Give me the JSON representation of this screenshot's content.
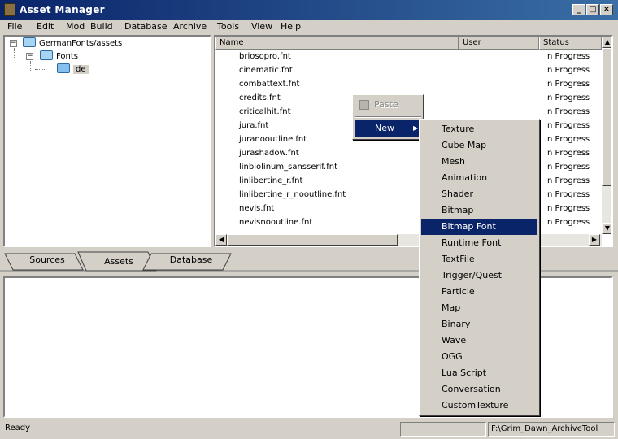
{
  "window": {
    "title": "Asset Manager"
  },
  "menu": [
    "File",
    "Edit",
    "Mod",
    "Build",
    "Database",
    "Archive",
    "Tools",
    "View",
    "Help"
  ],
  "tree": {
    "root": "GermanFonts/assets",
    "child": "Fonts",
    "leaf": "de"
  },
  "list": {
    "columns": {
      "name": "Name",
      "user": "User",
      "status": "Status"
    },
    "rows": [
      {
        "name": "briosopro.fnt",
        "status": "In Progress"
      },
      {
        "name": "cinematic.fnt",
        "status": "In Progress"
      },
      {
        "name": "combattext.fnt",
        "status": "In Progress"
      },
      {
        "name": "credits.fnt",
        "status": "In Progress"
      },
      {
        "name": "criticalhit.fnt",
        "status": "In Progress"
      },
      {
        "name": "jura.fnt",
        "status": "In Progress"
      },
      {
        "name": "juranooutline.fnt",
        "status": "In Progress"
      },
      {
        "name": "jurashadow.fnt",
        "status": "In Progress"
      },
      {
        "name": "linbiolinum_sansserif.fnt",
        "status": "In Progress"
      },
      {
        "name": "linlibertine_r.fnt",
        "status": "In Progress"
      },
      {
        "name": "linlibertine_r_nooutline.fnt",
        "status": "In Progress"
      },
      {
        "name": "nevis.fnt",
        "status": "In Progress"
      },
      {
        "name": "nevisnooutline.fnt",
        "status": "In Progress"
      }
    ]
  },
  "tabs": [
    "Sources",
    "Assets",
    "Database"
  ],
  "context_menu": {
    "paste": "Paste",
    "new": "New"
  },
  "submenu": [
    "Texture",
    "Cube Map",
    "Mesh",
    "Animation",
    "Shader",
    "Bitmap",
    "Bitmap Font",
    "Runtime Font",
    "TextFile",
    "Trigger/Quest",
    "Particle",
    "Map",
    "Binary",
    "Wave",
    "OGG",
    "Lua Script",
    "Conversation",
    "CustomTexture"
  ],
  "submenu_selected": "Bitmap Font",
  "status": {
    "text": "Ready",
    "path": "F:\\Grim_Dawn_ArchiveTool"
  }
}
